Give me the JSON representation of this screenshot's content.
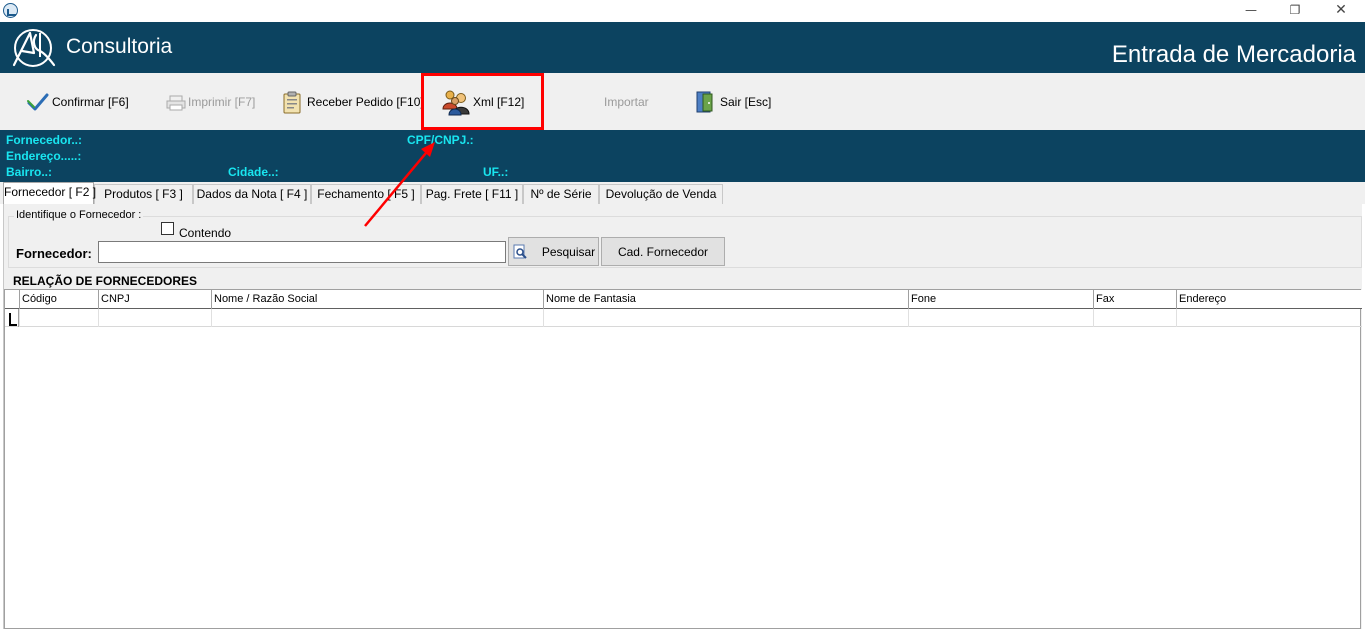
{
  "window": {
    "minimize_glyph": "—",
    "restore_glyph": "❐",
    "close_glyph": "✕"
  },
  "banner": {
    "logo_text": "Consultoria",
    "screen_title": "Entrada de Mercadoria",
    "background_color": "#0c4360"
  },
  "toolbar": {
    "confirm_label": "Confirmar [F6]",
    "print_label": "Imprimir  [F7]",
    "receive_order_label": "Receber Pedido [F10]",
    "xml_label": "Xml [F12]",
    "import_label": "Importar",
    "exit_label": "Sair [Esc]",
    "highlight_color": "#ff0000"
  },
  "info": {
    "supplier_label": "Fornecedor..:",
    "cpf_cnpj_label": "CPF/CNPJ.:",
    "address_label": "Endereço.....:",
    "district_label": "Bairro..:",
    "city_label": "Cidade..:",
    "uf_label": "UF..:",
    "text_color": "#19e6f0"
  },
  "tabs": [
    {
      "label": "Fornecedor [ F2 ]",
      "active": true
    },
    {
      "label": "Produtos [ F3 ]",
      "active": false
    },
    {
      "label": "Dados da Nota [ F4 ]",
      "active": false
    },
    {
      "label": "Fechamento [ F5 ]",
      "active": false
    },
    {
      "label": "Pag. Frete [ F11 ]",
      "active": false
    },
    {
      "label": "Nº de Série",
      "active": false
    },
    {
      "label": "Devolução de Venda",
      "active": false
    }
  ],
  "supplier_search": {
    "group_label": "Identifique o Fornecedor :",
    "contains_label": "Contendo",
    "contains_checked": false,
    "field_label": "Fornecedor:",
    "field_value": "",
    "search_button_label": "Pesquisar",
    "register_button_label": "Cad. Fornecedor"
  },
  "grid": {
    "title": "RELAÇÃO DE FORNECEDORES",
    "columns": [
      "Código",
      "CNPJ",
      "Nome / Razão Social",
      "Nome de Fantasia",
      "Fone",
      "Fax",
      "Endereço"
    ],
    "rows": []
  }
}
